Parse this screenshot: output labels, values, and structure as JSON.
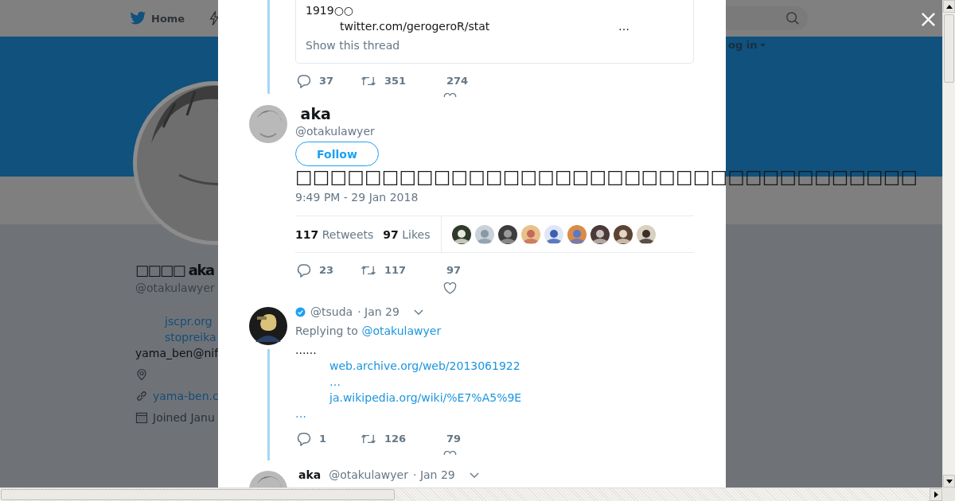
{
  "nav": {
    "home": "Home",
    "login": "og in"
  },
  "profile": {
    "name": "□□□□ aka",
    "handle": "@otakulawyer",
    "links": [
      "jscpr.org",
      "stopreika"
    ],
    "email": "yama_ben@nif",
    "website": "yama-ben.c",
    "joined": "Joined Janu"
  },
  "quoted_card": {
    "text": "1919○○",
    "link": "twitter.com/gerogeroR/stat",
    "link_ellipsis": "…",
    "show_thread": "Show this thread"
  },
  "quoted_actions": {
    "replies": "37",
    "retweets": "351",
    "likes": "274"
  },
  "main_tweet": {
    "name": " aka",
    "handle": "@otakulawyer",
    "follow": "Follow",
    "text": "□□□□□□□□□□□□□□□□□□□□□□□□□□□□□□□□□□□□",
    "time": "9:49 PM - 29 Jan 2018",
    "retweet_count": "117",
    "retweet_label": "Retweets",
    "like_count": "97",
    "like_label": "Likes",
    "replies": "23",
    "retweets": "117",
    "likes": "97"
  },
  "replies": [
    {
      "verified": true,
      "handle": "@tsuda",
      "date": "· Jan 29",
      "replying_label": "Replying to",
      "replying_to": "@otakulawyer",
      "text": "......",
      "lines": [
        {
          "kind": "link",
          "text": "web.archive.org/web/2013061922"
        },
        {
          "kind": "link",
          "text": "…"
        },
        {
          "kind": "link",
          "text": "ja.wikipedia.org/wiki/%E7%A5%9E"
        },
        {
          "kind": "tail",
          "text": "…"
        }
      ],
      "replies": "1",
      "retweets": "126",
      "likes": "79"
    },
    {
      "verified": false,
      "name": "aka",
      "handle": "@otakulawyer",
      "date": "· Jan 29"
    }
  ]
}
